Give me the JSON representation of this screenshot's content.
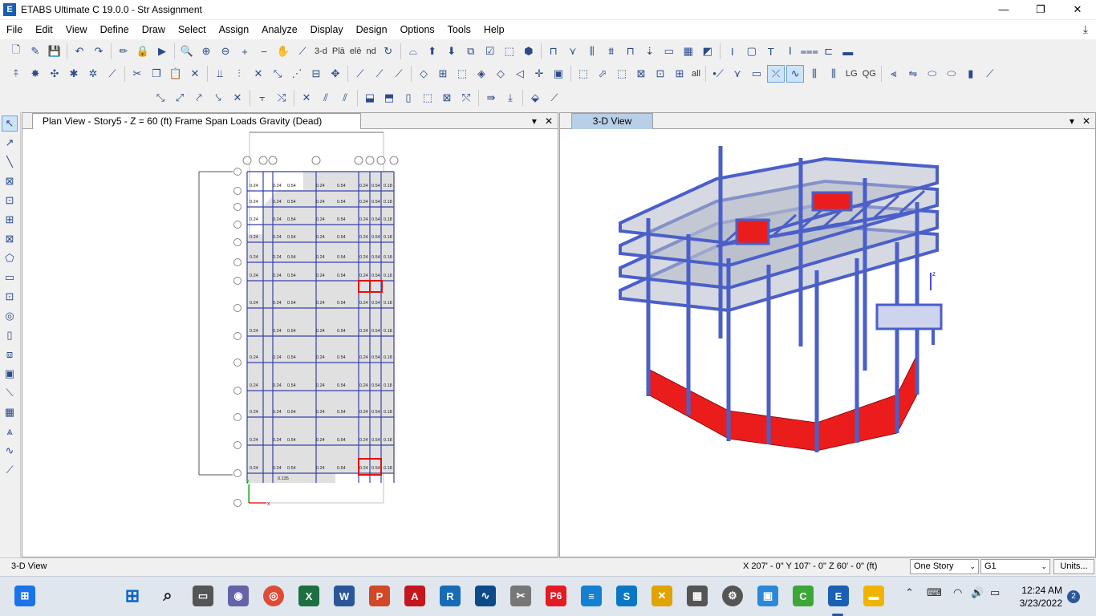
{
  "window": {
    "title": "ETABS Ultimate C 19.0.0 - Str Assignment",
    "logo": "E",
    "minimize": "—",
    "maximize": "❐",
    "close": "✕"
  },
  "menu": [
    "File",
    "Edit",
    "View",
    "Define",
    "Draw",
    "Select",
    "Assign",
    "Analyze",
    "Display",
    "Design",
    "Options",
    "Tools",
    "Help"
  ],
  "toolbar": {
    "view3d_label": "3-d",
    "plan_label": "Plā",
    "elev_label": "elē",
    "nd_label": "nd",
    "all_label": "all",
    "lg_label": "LG",
    "qg_label": "QG"
  },
  "panels": {
    "left": {
      "tab": "Plan View - Story5 - Z = 60 (ft)  Frame Span Loads Gravity (Dead)"
    },
    "right": {
      "tab": "3-D View"
    },
    "menu_arrow": "▾",
    "close": "✕"
  },
  "plan": {
    "load_values": [
      "0.54",
      "0.24",
      "0.18",
      "0.135"
    ],
    "axis_x": "x",
    "axis_y": "y"
  },
  "status": {
    "view_name": "3-D View",
    "coords": "X 207' - 0\"  Y 107' - 0\"  Z 60' - 0\" (ft)",
    "story_option": "One Story",
    "group_option": "G1",
    "units_button": "Units..."
  },
  "taskbar": {
    "time": "12:24 AM",
    "date": "3/23/2022",
    "notifications": "2",
    "icons": [
      "start-icon",
      "search-icon",
      "task-view-icon",
      "chat-icon",
      "chrome-icon",
      "excel-icon",
      "word-icon",
      "powerpoint-icon",
      "autocad-icon",
      "revit-icon",
      "app-icon",
      "snip-icon",
      "primavera-icon",
      "notes-icon",
      "sharepoint-icon",
      "app2-icon",
      "calculator-icon",
      "settings-icon",
      "app3-icon",
      "camtasia-icon",
      "etabs-icon",
      "explorer-icon"
    ]
  },
  "colors": {
    "frame": "#4b5fc9",
    "wall": "#ea1c1c",
    "accent": "#2b5797"
  }
}
